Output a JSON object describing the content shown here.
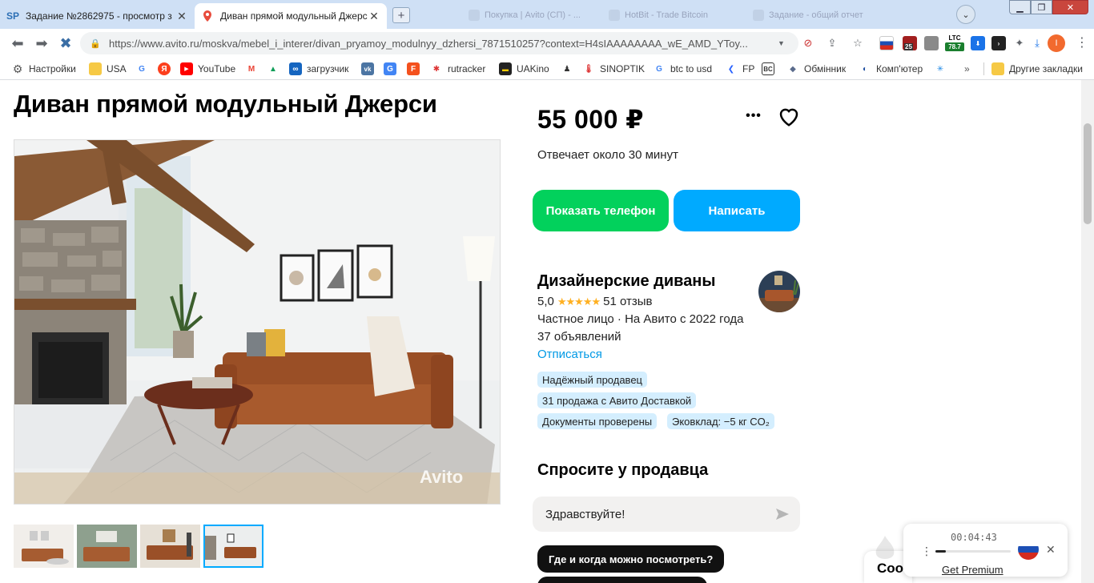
{
  "browser": {
    "tabs": [
      {
        "label": "Задание №2862975 - просмотр з",
        "favicon": "SP"
      },
      {
        "label": "Диван прямой модульный Джерс",
        "favicon": "avito-pin"
      }
    ],
    "ghost_tabs": [
      "Покупка | Avito (СП) - ...",
      "HotBit - Trade Bitcoin",
      "Задание - общий отчет"
    ],
    "url": "https://www.avito.ru/moskva/mebel_i_interer/divan_pryamoy_modulnyy_dzhersi_7871510257?context=H4sIAAAAAAAA_wE_AMD_YToy...",
    "ext_badge_count": "25",
    "ltc": {
      "label": "LTC",
      "value": "78.7"
    },
    "profile_initial": "I"
  },
  "bookmarks": [
    {
      "label": "Настройки",
      "icon": "gear-icon"
    },
    {
      "label": "USA",
      "icon": "folder-icon"
    },
    {
      "label": "",
      "icon": "google-icon"
    },
    {
      "label": "",
      "icon": "yandex-icon"
    },
    {
      "label": "YouTube",
      "icon": "youtube-icon"
    },
    {
      "label": "",
      "icon": "gmail-icon"
    },
    {
      "label": "",
      "icon": "drive-icon"
    },
    {
      "label": "загрузчик",
      "icon": "loader-icon"
    },
    {
      "label": "",
      "icon": "vk-icon"
    },
    {
      "label": "",
      "icon": "translate-icon"
    },
    {
      "label": "",
      "icon": "flex-icon"
    },
    {
      "label": "rutracker",
      "icon": "rutracker-icon"
    },
    {
      "label": "UAKino",
      "icon": "uakino-icon"
    },
    {
      "label": "",
      "icon": "figure-icon"
    },
    {
      "label": "SINOPTIK",
      "icon": "thermometer-icon"
    },
    {
      "label": "btc to usd",
      "icon": "google-icon"
    },
    {
      "label": "FP",
      "icon": "fp-icon"
    },
    {
      "label": "",
      "icon": "bc-icon"
    },
    {
      "label": "Обмінник",
      "icon": "exchange-icon"
    },
    {
      "label": "Комп'ютер",
      "icon": "computer-icon"
    },
    {
      "label": "",
      "icon": "snowflake-icon"
    },
    {
      "label": "Другие закладки",
      "icon": "folder-icon"
    }
  ],
  "listing": {
    "title": "Диван прямой модульный Джерси",
    "price": "55 000 ₽",
    "respond_time": "Отвечает около 30 минут",
    "btn_phone": "Показать телефон",
    "btn_write": "Написать",
    "photo_watermark": "Avito",
    "thumbnails": 4,
    "selected_thumbnail": 4
  },
  "seller": {
    "name": "Дизайнерские диваны",
    "rating": "5,0",
    "stars": "★★★★★",
    "reviews": "51 отзыв",
    "type_line": "Частное лицо · На Авито с 2022 года",
    "ads_line": "37 объявлений",
    "unsubscribe": "Отписаться",
    "badges": [
      "Надёжный продавец",
      "31 продажа с Авито Доставкой",
      "Документы проверены",
      "Эковклад: −5 кг CO₂"
    ]
  },
  "ask": {
    "title": "Спросите у продавца",
    "input_value": "Здравствуйте!",
    "suggestions": [
      "Где и когда можно посмотреть?"
    ]
  },
  "overlay": {
    "cookie_text": "Coo",
    "player_time": "00:04:43",
    "player_progress": 0.14,
    "player_premium": "Get Premium"
  },
  "colors": {
    "green": "#02d15c",
    "blue": "#00aaff",
    "link": "#0099e5",
    "badge_bg": "#d4eefe",
    "star": "#ffb021"
  }
}
